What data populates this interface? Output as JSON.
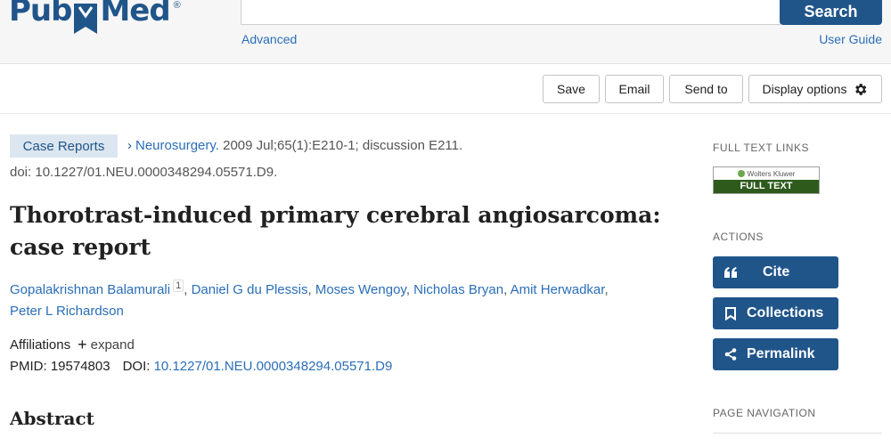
{
  "header": {
    "logo_left": "Pub",
    "logo_right": "Med",
    "logo_reg": "®",
    "search_button": "Search",
    "advanced_link": "Advanced",
    "user_guide_link": "User Guide"
  },
  "toolbar": {
    "save": "Save",
    "email": "Email",
    "send_to": "Send to",
    "display_options": "Display options"
  },
  "article": {
    "type_badge": "Case Reports",
    "journal": "Neurosurgery.",
    "citation": " 2009 Jul;65(1):E210-1; discussion E211.",
    "doi_line": "doi: 10.1227/01.NEU.0000348294.05571.D9.",
    "title": "Thorotrast-induced primary cerebral angiosarcoma: case report",
    "authors": [
      "Gopalakrishnan Balamurali",
      "Daniel G du Plessis",
      "Moses Wengoy",
      "Nicholas Bryan",
      "Amit Herwadkar",
      "Peter L Richardson"
    ],
    "first_author_sup": "1",
    "affiliations_label": "Affiliations",
    "expand_label": "expand",
    "pmid_text": "PMID: 19574803",
    "doi_label": "DOI: ",
    "doi_value": "10.1227/01.NEU.0000348294.05571.D9",
    "abstract_heading": "Abstract"
  },
  "sidebar": {
    "full_text_links_heading": "FULL TEXT LINKS",
    "wk_brand": "Wolters Kluwer",
    "wk_full_text": "FULL TEXT",
    "actions_heading": "ACTIONS",
    "cite": "Cite",
    "collections": "Collections",
    "permalink": "Permalink",
    "page_navigation_heading": "PAGE NAVIGATION"
  },
  "colors": {
    "brand_blue": "#20558a",
    "link_blue": "#2a6eb8",
    "badge_bg": "#dce6f0",
    "wk_green": "#2e5b1c"
  }
}
